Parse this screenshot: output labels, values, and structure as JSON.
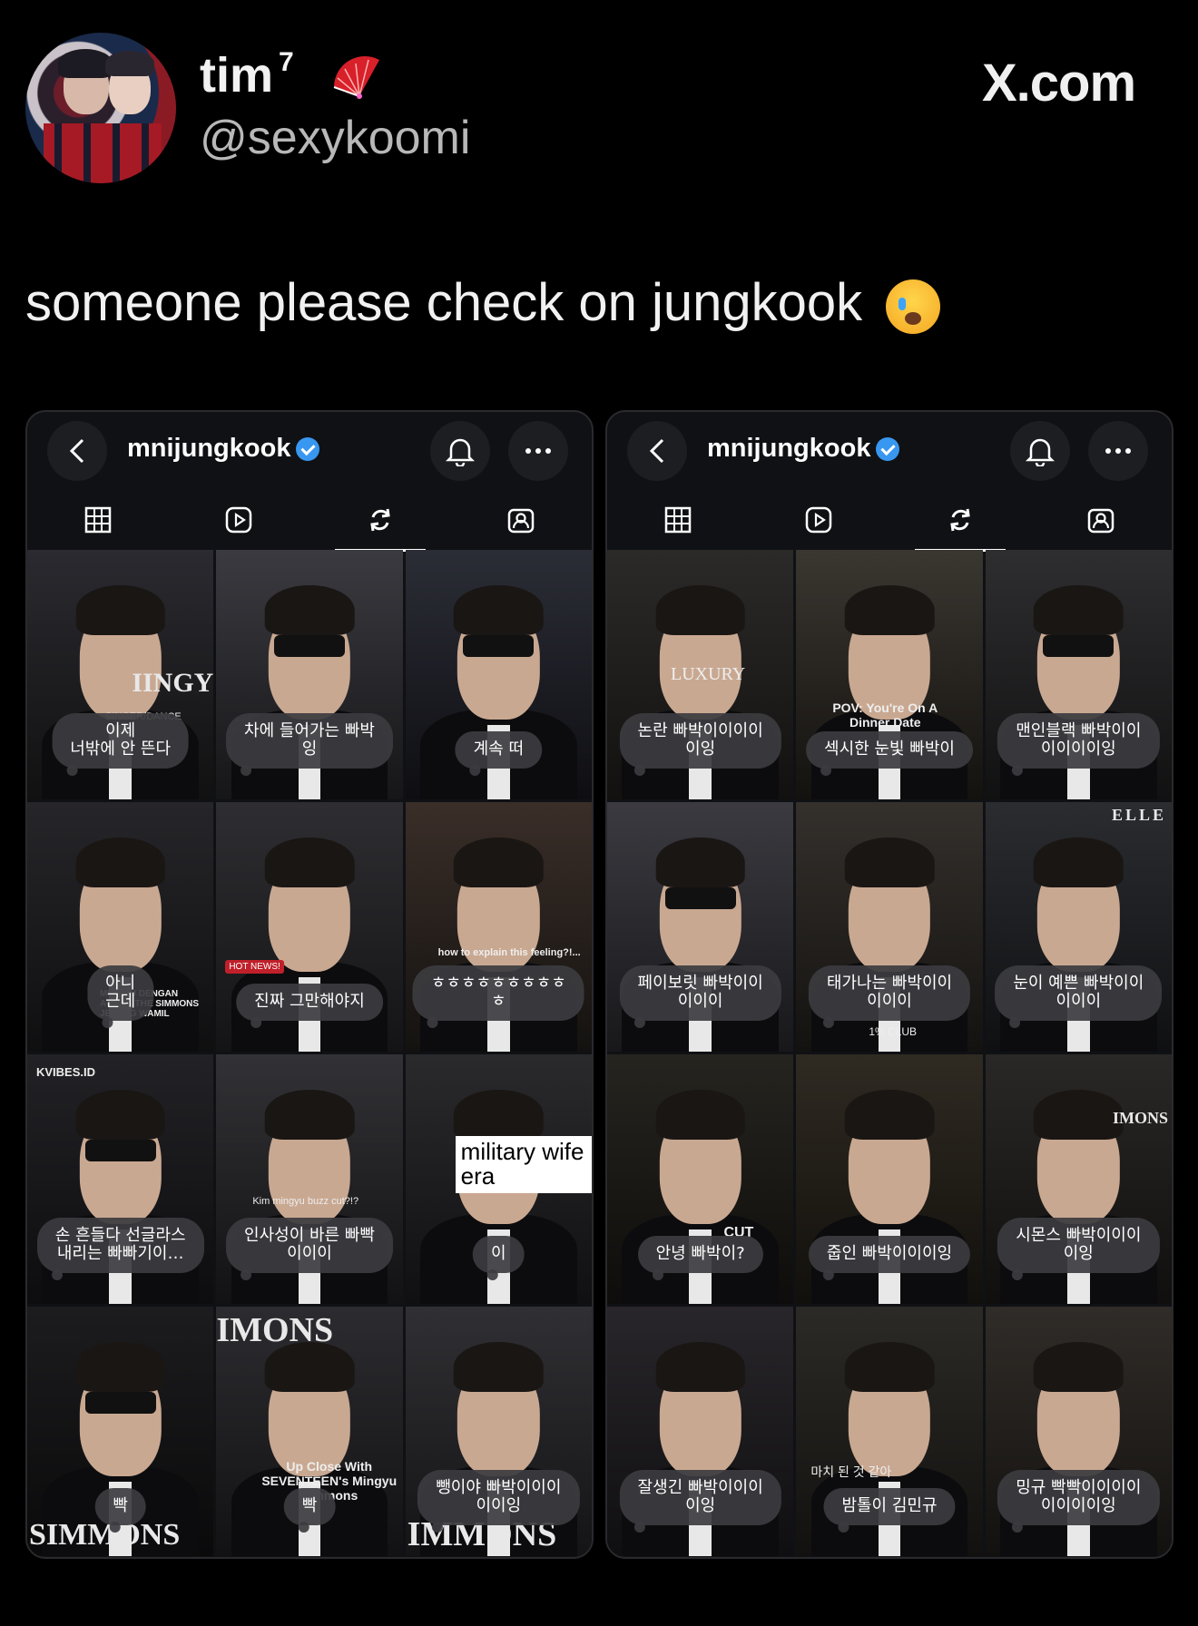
{
  "tweet": {
    "display_name": "tim",
    "superscript": "7",
    "handle": "@sexykoomi",
    "source": "X.com",
    "text": "someone please check on jungkook"
  },
  "panels": [
    {
      "username": "mnijungkook",
      "tiles": [
        {
          "bubble": "이제\n너밖에 안 뜬다",
          "overlay": "IINGY",
          "caption": "SINGER/DANCE"
        },
        {
          "bubble": "차에 들어가는 빠박\n잉"
        },
        {
          "bubble": "계속 떠"
        },
        {
          "bubble": "아니\n근데",
          "caption": "MINGYU DENGAN\nACARA THE SIMMONS\nJELANG WAMIL"
        },
        {
          "bubble": "진짜 그만해야지",
          "badge": "HOT NEWS!"
        },
        {
          "bubble": "ㅎㅎㅎㅎㅎㅎㅎㅎㅎ\nㅎ",
          "caption": "how to explain this feeling?!..."
        },
        {
          "bubble": "손 흔들다 선글라스\n내리는 빠빠기이…",
          "caption": "KVIBES.ID"
        },
        {
          "bubble": "인사성이 바른 빠빡\n이이이",
          "caption": "Kim mingyu buzz cut?!?"
        },
        {
          "bubble": "이",
          "overlay": "military\nwife era"
        },
        {
          "bubble": "빡",
          "overlay": "SIMMONS"
        },
        {
          "bubble": "빡",
          "overlay": "IMONS",
          "caption": "Up Close With\nSEVENTEEN's Mingyu\nSimmons"
        },
        {
          "bubble": "뺑이야 빠박이이이\n이이잉",
          "overlay": "IMMONS"
        }
      ]
    },
    {
      "username": "mnijungkook",
      "tiles": [
        {
          "bubble": "논란 빠박이이이이\n이잉",
          "caption": "LUXURY"
        },
        {
          "bubble": "섹시한 눈빛 빠박이",
          "caption": "POV: You're On A\nDinner Date"
        },
        {
          "bubble": "맨인블랙 빠박이이\n이이이이잉"
        },
        {
          "bubble": "페이보릿 빠박이이\n이이이"
        },
        {
          "bubble": "태가나는 빠박이이\n이이이",
          "caption": "1% CLUB"
        },
        {
          "bubble": "눈이 예쁜 빠박이이\n이이이",
          "overlay": "ELLE"
        },
        {
          "bubble": "안녕 빠박이?",
          "caption": "CUT"
        },
        {
          "bubble": "줍인 빠박이이이잉"
        },
        {
          "bubble": "시몬스 빠박이이이\n이잉",
          "overlay": "IMONS"
        },
        {
          "bubble": "잘생긴 빠박이이이\n이잉"
        },
        {
          "bubble": "밤톨이 김민규",
          "caption": "마치 된 것 같아"
        },
        {
          "bubble": "밍규 빡빡이이이이\n이이이이잉"
        }
      ]
    }
  ],
  "colors": {
    "background": "#000000",
    "panel": "#101114",
    "bubble": "#3c3c40",
    "verified": "#3897f0"
  },
  "icons": [
    "back-icon",
    "bell-icon",
    "more-icon",
    "grid-icon",
    "reels-icon",
    "reposts-icon",
    "tagged-icon",
    "verified-icon",
    "fan-icon",
    "crying-emoji"
  ]
}
